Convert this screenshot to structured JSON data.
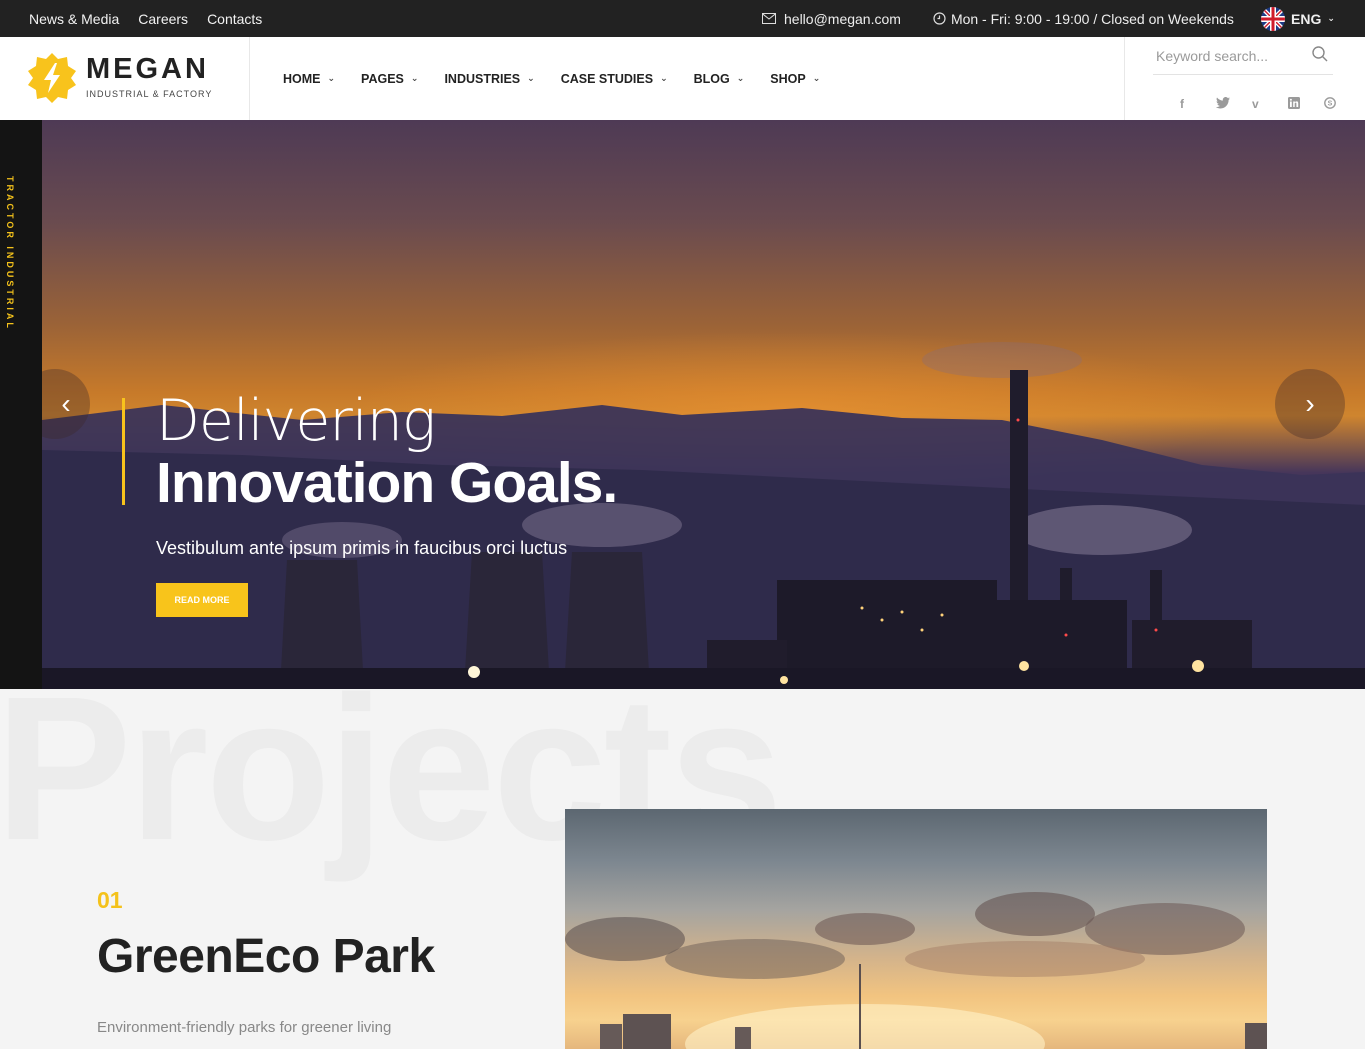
{
  "topbar": {
    "links": [
      "News & Media",
      "Careers",
      "Contacts"
    ],
    "email": "hello@megan.com",
    "hours": "Mon - Fri: 9:00 - 19:00 / Closed on Weekends",
    "language": "ENG"
  },
  "header": {
    "logo_title": "MEGAN",
    "logo_subtitle": "INDUSTRIAL & FACTORY",
    "nav": [
      {
        "label": "HOME"
      },
      {
        "label": "PAGES"
      },
      {
        "label": "INDUSTRIES"
      },
      {
        "label": "CASE STUDIES"
      },
      {
        "label": "BLOG"
      },
      {
        "label": "SHOP"
      }
    ],
    "search_placeholder": "Keyword search...",
    "socials": [
      "facebook-icon",
      "twitter-icon",
      "vimeo-icon",
      "linkedin-icon",
      "skype-icon"
    ]
  },
  "hero": {
    "side_label": "TRACTOR INDUSTRIAL",
    "line1": "Delivering",
    "line2": "Innovation Goals.",
    "subtitle": "Vestibulum ante ipsum primis in faucibus orci luctus",
    "button": "READ MORE"
  },
  "projects": {
    "watermark": "Projects",
    "number": "01",
    "title": "GreenEco Park",
    "description": "Environment-friendly parks for greener living"
  },
  "colors": {
    "accent": "#f8c31c",
    "topbar_bg": "#222222",
    "sidebar_bg": "#141414"
  }
}
